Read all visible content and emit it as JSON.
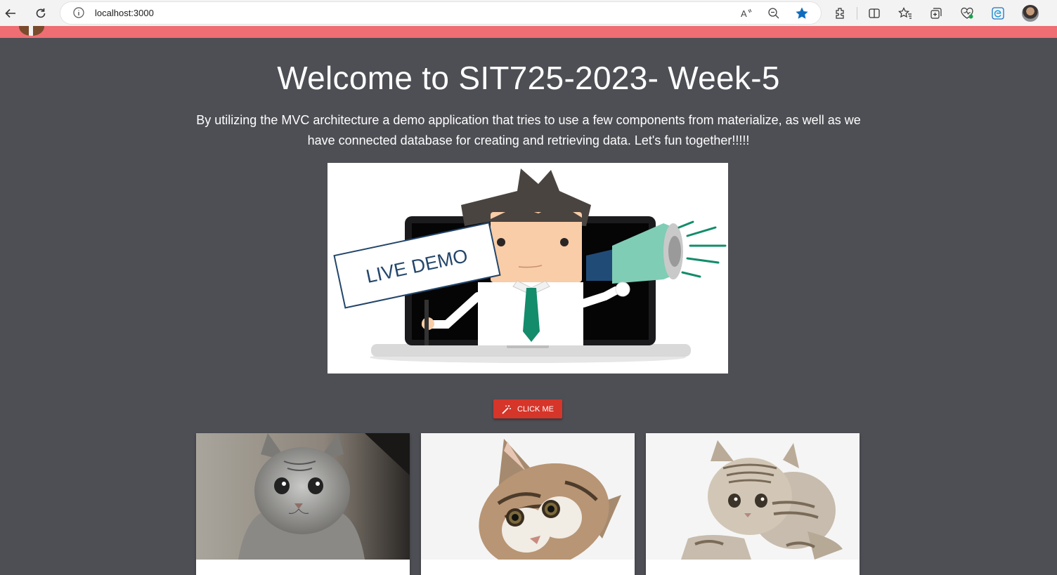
{
  "browser": {
    "url": "localhost:3000",
    "icons": [
      "back-arrow-icon",
      "refresh-icon",
      "site-info-icon",
      "read-aloud-icon",
      "zoom-out-icon",
      "favorite-star-filled-icon",
      "extensions-icon",
      "split-screen-icon",
      "favorites-icon",
      "collections-icon",
      "browser-essentials-icon",
      "edge-icon",
      "profile-avatar"
    ]
  },
  "navbar": {
    "color": "#ee6e73"
  },
  "main": {
    "title": "Welcome to SIT725-2023- Week-5",
    "subtitle": "By utilizing the MVC architecture a demo application that tries to use a few components from materialize, as well as we have connected database for creating and retrieving data. Let's fun together!!!!!",
    "hero_sign_text": "LIVE DEMO",
    "button": {
      "label": "CLICK ME",
      "icon": "magic-wand-icon",
      "color": "#d6352a"
    },
    "cards": [
      {
        "image": "gray-tabby-kitten-photo"
      },
      {
        "image": "peeking-tabby-kitten-photo"
      },
      {
        "image": "sitting-tabby-kitten-photo"
      }
    ]
  }
}
